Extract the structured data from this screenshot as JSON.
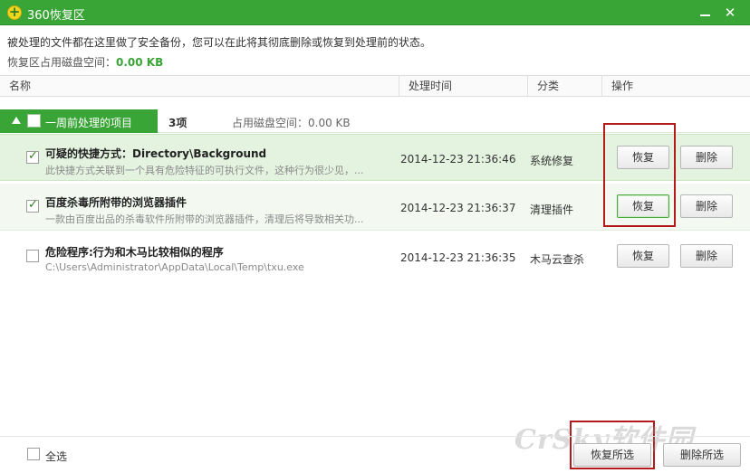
{
  "window": {
    "title": "360恢复区",
    "minimize": "",
    "close": "✕"
  },
  "info": {
    "line1": "被处理的文件都在这里做了安全备份，您可以在此将其彻底删除或恢复到处理前的状态。",
    "line2_label": "恢复区占用磁盘空间：",
    "line2_size": "0.00 KB"
  },
  "table": {
    "headers": {
      "name": "名称",
      "time": "处理时间",
      "category": "分类",
      "action": "操作"
    }
  },
  "group": {
    "name": "一周前处理的项目",
    "count": "3项",
    "size": "占用磁盘空间：0.00 KB"
  },
  "rows": [
    {
      "checked": true,
      "name": "可疑的快捷方式：Directory\\Background",
      "desc": "此快捷方式关联到一个具有危险特征的可执行文件，这种行为很少见，...",
      "time": "2014-12-23 21:36:46",
      "category": "系统修复",
      "restore": "恢复",
      "delete": "删除"
    },
    {
      "checked": true,
      "name": "百度杀毒所附带的浏览器插件",
      "desc": "一款由百度出品的杀毒软件所附带的浏览器插件，清理后将导致相关功...",
      "time": "2014-12-23 21:36:37",
      "category": "清理插件",
      "restore": "恢复",
      "delete": "删除"
    },
    {
      "checked": false,
      "name": "危险程序:行为和木马比较相似的程序",
      "desc": "C:\\Users\\Administrator\\AppData\\Local\\Temp\\txu.exe",
      "time": "2014-12-23 21:36:35",
      "category": "木马云查杀",
      "restore": "恢复",
      "delete": "删除"
    }
  ],
  "footer": {
    "select_all": "全选",
    "restore_selected": "恢复所选",
    "delete_selected": "删除所选"
  },
  "watermark": "CrSky软件园",
  "colors": {
    "accent": "#3aa537",
    "highlight_box": "#b31b1b"
  }
}
